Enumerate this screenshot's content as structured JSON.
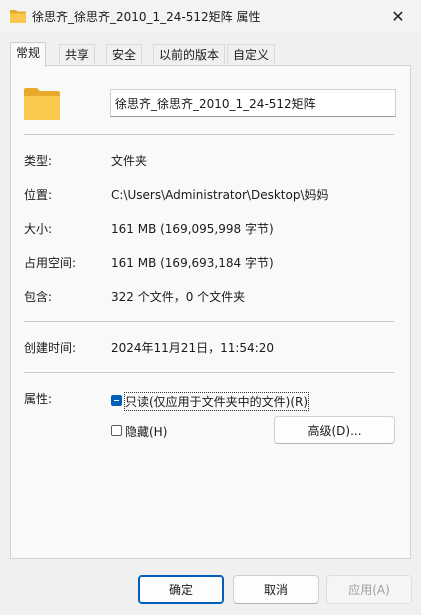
{
  "window": {
    "title": "徐思齐_徐思齐_2010_1_24-512矩阵 属性",
    "close_glyph": "✕"
  },
  "tabs": [
    {
      "label": "常规",
      "active": true
    },
    {
      "label": "共享",
      "active": false
    },
    {
      "label": "安全",
      "active": false
    },
    {
      "label": "以前的版本",
      "active": false
    },
    {
      "label": "自定义",
      "active": false
    }
  ],
  "general": {
    "folder_name": "徐思齐_徐思齐_2010_1_24-512矩阵",
    "type": {
      "label": "类型:",
      "value": "文件夹"
    },
    "location": {
      "label": "位置:",
      "value": "C:\\Users\\Administrator\\Desktop\\妈妈"
    },
    "size": {
      "label": "大小:",
      "value": "161 MB (169,095,998 字节)"
    },
    "size_on_disk": {
      "label": "占用空间:",
      "value": "161 MB (169,693,184 字节)"
    },
    "contains": {
      "label": "包含:",
      "value": "322 个文件，0 个文件夹"
    },
    "created": {
      "label": "创建时间:",
      "value": "2024年11月21日，11:54:20"
    },
    "attributes_label": "属性:",
    "readonly_label": "只读(仅应用于文件夹中的文件)(R)",
    "readonly_state": "mixed",
    "hidden_label": "隐藏(H)",
    "hidden_state": "unchecked",
    "advanced_button": "高级(D)..."
  },
  "footer": {
    "ok": "确定",
    "cancel": "取消",
    "apply": "应用(A)"
  },
  "colors": {
    "accent": "#005fb8",
    "folder": "#f8c94d"
  },
  "icons": {
    "title_icon": "folder-icon",
    "big_icon": "folder-icon",
    "close": "close-icon"
  }
}
